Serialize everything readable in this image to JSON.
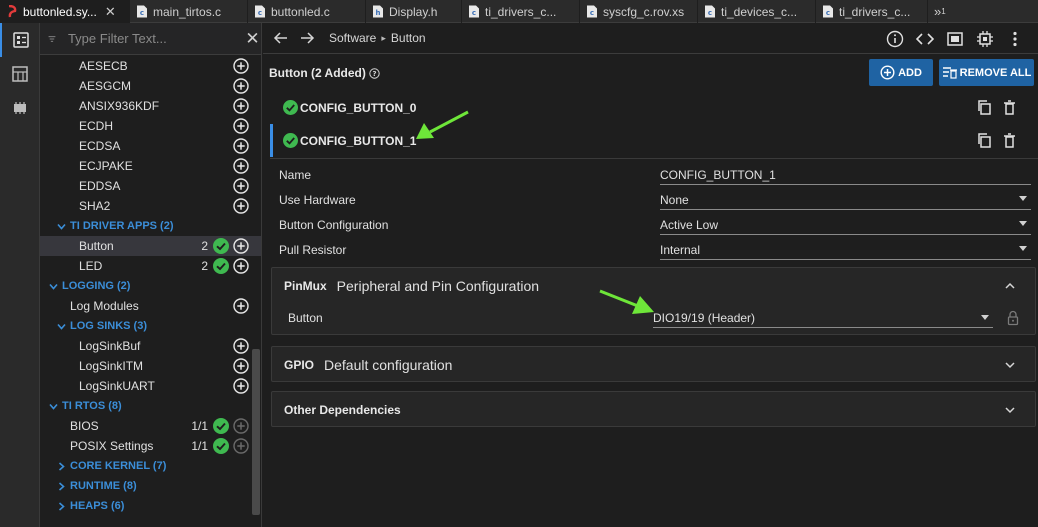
{
  "tabs": [
    {
      "label": "buttonled.sy...",
      "active": true,
      "icon": "sysconfig-file-icon"
    },
    {
      "label": "main_tirtos.c",
      "icon": "c-file-icon"
    },
    {
      "label": "buttonled.c",
      "icon": "c-file-icon"
    },
    {
      "label": "Display.h",
      "icon": "h-file-icon"
    },
    {
      "label": "ti_drivers_c...",
      "icon": "c-file-icon"
    },
    {
      "label": "syscfg_c.rov.xs",
      "icon": "c-file-icon"
    },
    {
      "label": "ti_devices_c...",
      "icon": "c-file-icon"
    },
    {
      "label": "ti_drivers_c...",
      "icon": "c-file-icon"
    }
  ],
  "tab_overflow": "»",
  "tab_overflow_count": "1",
  "filter": {
    "placeholder": "Type Filter Text..."
  },
  "tree": [
    {
      "label": "AESECB",
      "level": 4,
      "add": true
    },
    {
      "label": "AESGCM",
      "level": 4,
      "add": true
    },
    {
      "label": "ANSIX936KDF",
      "level": 4,
      "add": true
    },
    {
      "label": "ECDH",
      "level": 4,
      "add": true
    },
    {
      "label": "ECDSA",
      "level": 4,
      "add": true
    },
    {
      "label": "ECJPAKE",
      "level": 4,
      "add": true
    },
    {
      "label": "EDDSA",
      "level": 4,
      "add": true
    },
    {
      "label": "SHA2",
      "level": 4,
      "add": true
    },
    {
      "label": "TI DRIVER APPS (2)",
      "level": 2,
      "category": true,
      "expanded": true
    },
    {
      "label": "Button",
      "level": 4,
      "count": "2",
      "check": true,
      "add": true,
      "selected": true
    },
    {
      "label": "LED",
      "level": 4,
      "count": "2",
      "check": true,
      "add": true
    },
    {
      "label": "LOGGING (2)",
      "level": 1,
      "category": true,
      "expanded": true
    },
    {
      "label": "Log Modules",
      "level": 3,
      "add": true
    },
    {
      "label": "LOG SINKS (3)",
      "level": 2,
      "category": true,
      "expanded": true
    },
    {
      "label": "LogSinkBuf",
      "level": 4,
      "add": true
    },
    {
      "label": "LogSinkITM",
      "level": 4,
      "add": true
    },
    {
      "label": "LogSinkUART",
      "level": 4,
      "add": true
    },
    {
      "label": "TI RTOS (8)",
      "level": 1,
      "category": true,
      "expanded": true
    },
    {
      "label": "BIOS",
      "level": 3,
      "count": "1/1",
      "check": true,
      "add": true,
      "add_disabled": true
    },
    {
      "label": "POSIX Settings",
      "level": 3,
      "count": "1/1",
      "check": true,
      "add": true,
      "add_disabled": true
    },
    {
      "label": "CORE KERNEL (7)",
      "level": 2,
      "category": true,
      "expanded": false
    },
    {
      "label": "RUNTIME (8)",
      "level": 2,
      "category": true,
      "expanded": false
    },
    {
      "label": "HEAPS (6)",
      "level": 2,
      "category": true,
      "expanded": false
    }
  ],
  "breadcrumb": {
    "root": "Software",
    "sep": "▸",
    "leaf": "Button"
  },
  "header": {
    "title": "Button (2 Added)"
  },
  "buttons": {
    "add": "ADD",
    "remove_all": "REMOVE ALL"
  },
  "instances": [
    {
      "name": "CONFIG_BUTTON_0",
      "selected": false
    },
    {
      "name": "CONFIG_BUTTON_1",
      "selected": true
    }
  ],
  "properties": [
    {
      "label": "Name",
      "value": "CONFIG_BUTTON_1",
      "dropdown": false
    },
    {
      "label": "Use Hardware",
      "value": "None",
      "dropdown": true
    },
    {
      "label": "Button Configuration",
      "value": "Active Low",
      "dropdown": true
    },
    {
      "label": "Pull Resistor",
      "value": "Internal",
      "dropdown": true
    }
  ],
  "pinmux": {
    "title": "PinMux",
    "desc": "Peripheral and Pin Configuration",
    "row_label": "Button",
    "value": "DIO19/19 (Header)"
  },
  "gpio": {
    "title": "GPIO",
    "desc": "Default configuration"
  },
  "other": {
    "title": "Other Dependencies"
  },
  "colors": {
    "accent": "#3a8ee6",
    "button": "#1f63a3",
    "check": "#3fb950",
    "annotation": "#6ee639",
    "category": "#3b8ed8"
  }
}
